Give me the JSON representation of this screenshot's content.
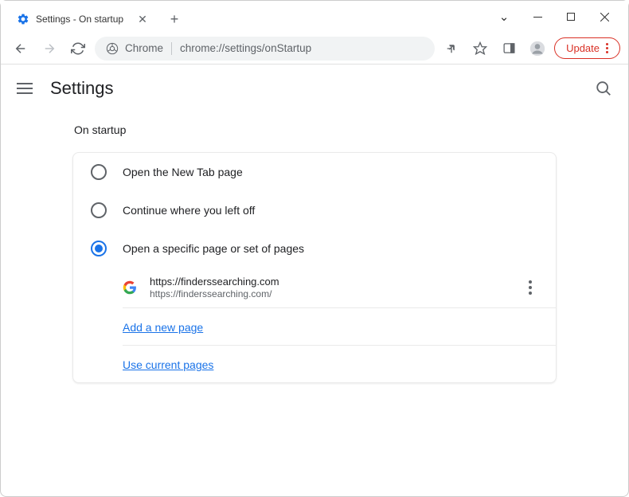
{
  "window": {
    "tab_title": "Settings - On startup"
  },
  "toolbar": {
    "address_prefix": "Chrome",
    "address_url": "chrome://settings/onStartup",
    "update_label": "Update"
  },
  "page": {
    "title": "Settings",
    "section_label": "On startup"
  },
  "startup": {
    "options": [
      {
        "label": "Open the New Tab page",
        "selected": false
      },
      {
        "label": "Continue where you left off",
        "selected": false
      },
      {
        "label": "Open a specific page or set of pages",
        "selected": true
      }
    ],
    "pages": [
      {
        "name": "https://finderssearching.com",
        "url": "https://finderssearching.com/"
      }
    ],
    "add_link": "Add a new page",
    "use_current_link": "Use current pages"
  }
}
